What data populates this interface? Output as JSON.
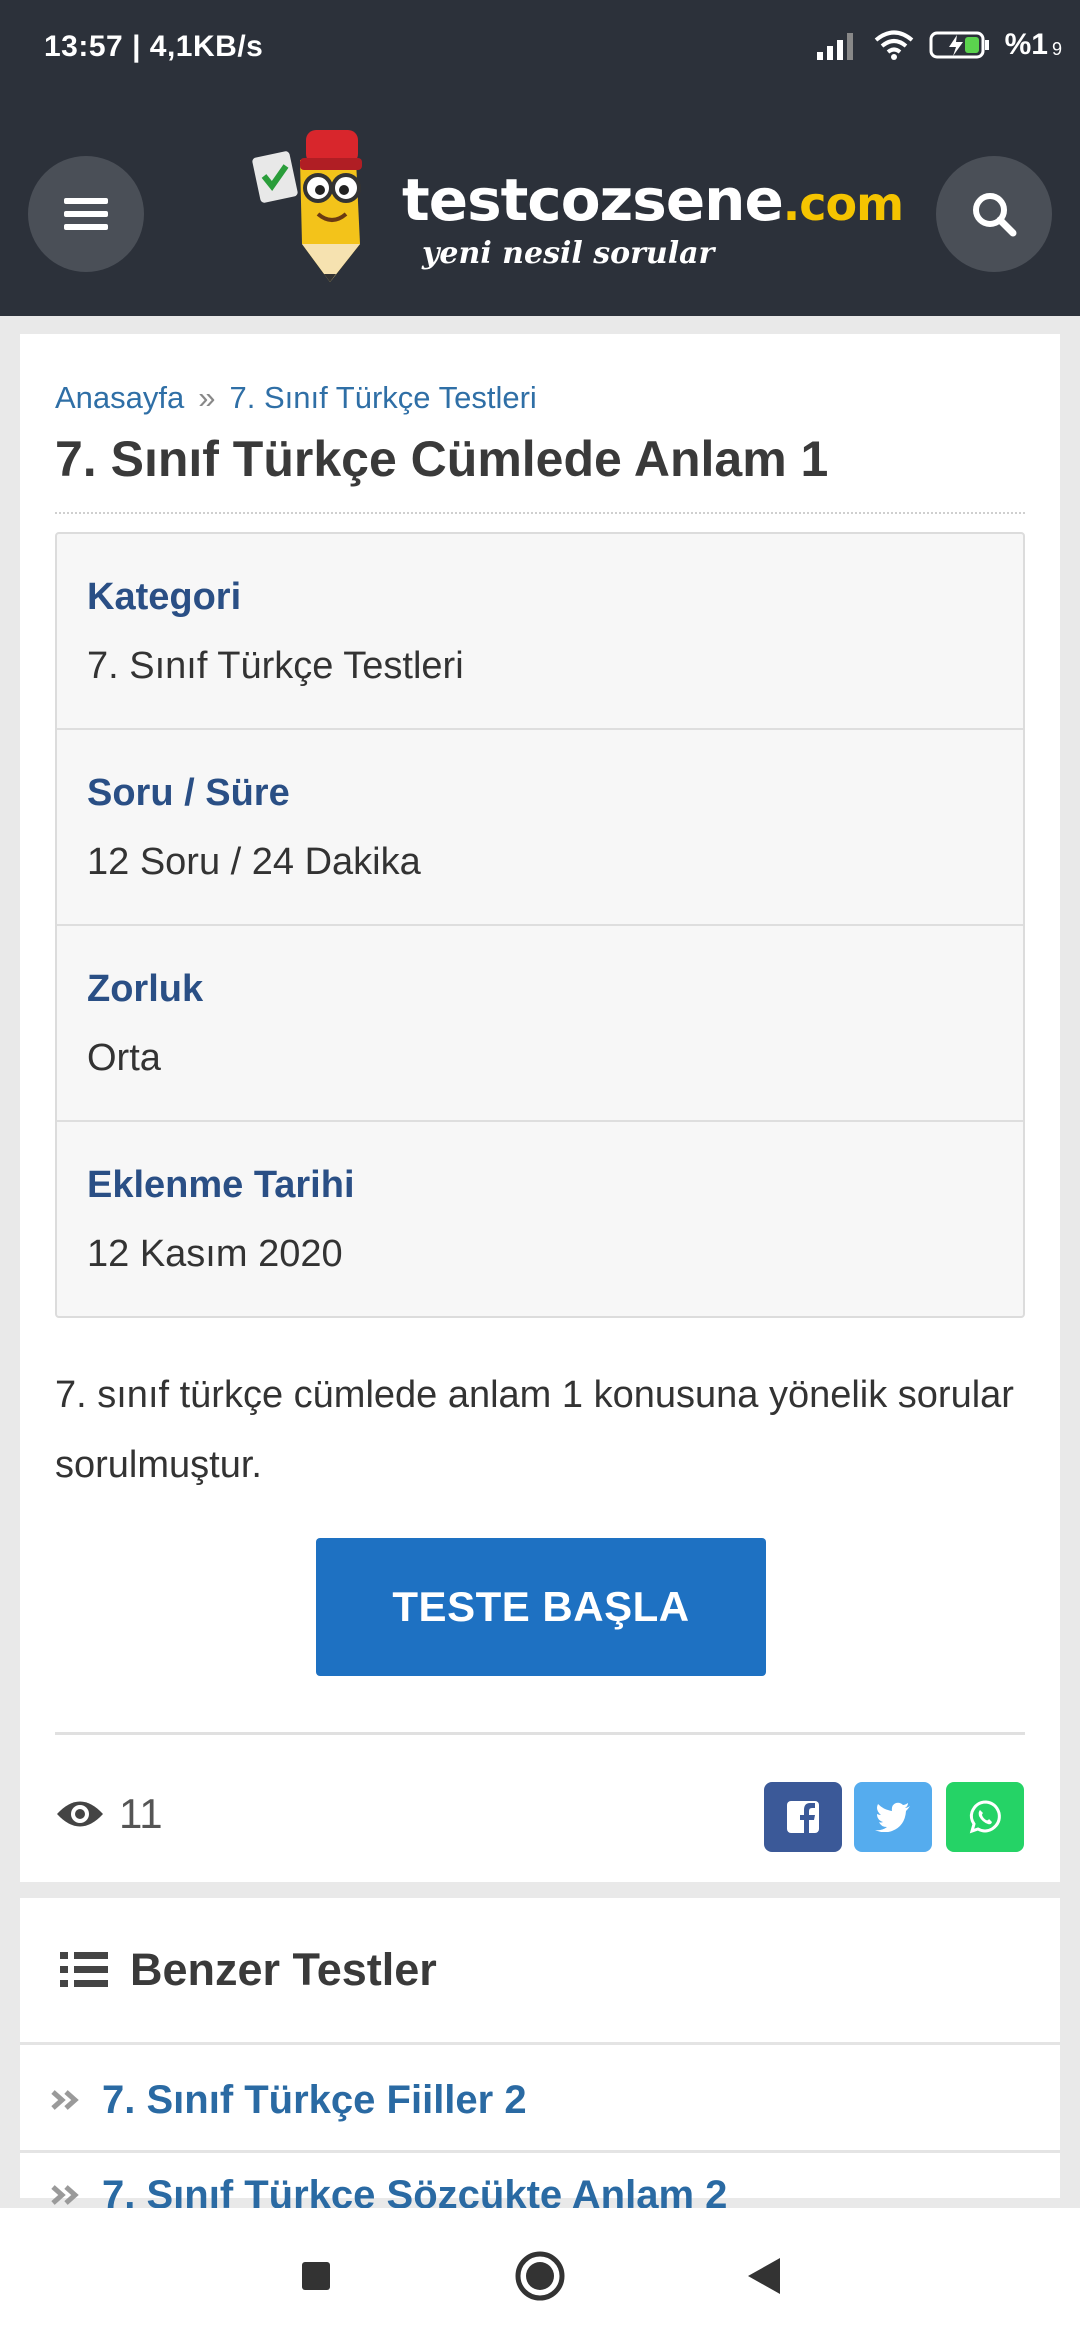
{
  "status_bar": {
    "time": "13:57 | 4,1KB/s",
    "battery": "%1",
    "battery_small": "9"
  },
  "header": {
    "logo_main": "testcozsene",
    "logo_domain": ".com",
    "logo_tagline": "yeni nesil sorular",
    "menu_icon": "hamburger-icon",
    "search_icon": "search-icon"
  },
  "breadcrumb": {
    "home": "Anasayfa",
    "separator": "»",
    "category": "7. Sınıf Türkçe Testleri"
  },
  "page_title": "7. Sınıf Türkçe Cümlede Anlam 1",
  "info": [
    {
      "label": "Kategori",
      "value": "7. Sınıf Türkçe Testleri"
    },
    {
      "label": "Soru / Süre",
      "value": "12 Soru / 24 Dakika"
    },
    {
      "label": "Zorluk",
      "value": "Orta"
    },
    {
      "label": "Eklenme Tarihi",
      "value": "12 Kasım 2020"
    }
  ],
  "description": "7. sınıf türkçe cümlede anlam 1 konusuna yönelik sorular sorulmuştur.",
  "start_button": "TESTE BAŞLA",
  "views": "11",
  "colors": {
    "header_bg": "#2c313a",
    "primary": "#1e71c2",
    "label": "#2a4f85",
    "facebook": "#3b5998",
    "twitter": "#55acee",
    "whatsapp": "#25d366"
  },
  "similar": {
    "heading": "Benzer Testler",
    "items": [
      "7. Sınıf Türkçe Fiiller 2",
      "7. Sınıf Türkçe Sözcükte Anlam 2"
    ]
  }
}
